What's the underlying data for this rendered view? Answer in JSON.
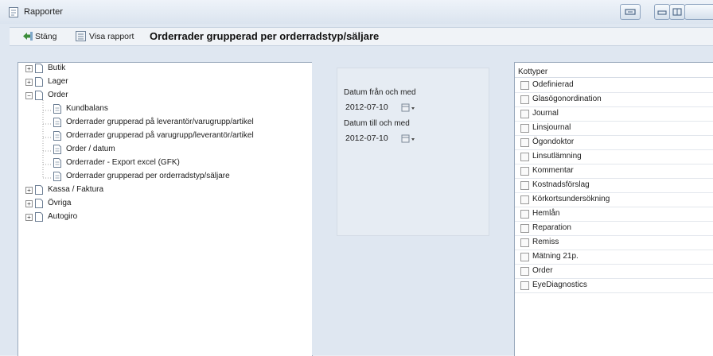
{
  "window": {
    "title": "Rapporter",
    "title_icon": "report-icon"
  },
  "toolbar": {
    "close_label": "Stäng",
    "show_report_label": "Visa rapport",
    "report_title": "Orderrader grupperad per orderradstyp/säljare"
  },
  "tree": {
    "nodes": [
      {
        "label": "Butik",
        "expander": "+"
      },
      {
        "label": "Lager",
        "expander": "+"
      },
      {
        "label": "Order",
        "expander": "−"
      },
      {
        "label": "Kundbalans"
      },
      {
        "label": "Orderrader grupperad på leverantör/varugrupp/artikel"
      },
      {
        "label": "Orderrader grupperad på varugrupp/leverantör/artikel"
      },
      {
        "label": "Order / datum"
      },
      {
        "label": "Orderrader - Export excel (GFK)"
      },
      {
        "label": "Orderrader grupperad per orderradstyp/säljare"
      },
      {
        "label": "Kassa / Faktura",
        "expander": "+"
      },
      {
        "label": "Övriga",
        "expander": "+"
      },
      {
        "label": "Autogiro",
        "expander": "+"
      }
    ]
  },
  "dates": {
    "from_label": "Datum från och med",
    "from_value": "2012-07-10",
    "to_label": "Datum till och med",
    "to_value": "2012-07-10"
  },
  "kottyper": {
    "header": "Kottyper",
    "items": [
      "Odefinierad",
      "Glasögonordination",
      "Journal",
      "Linsjournal",
      "Ögondoktor",
      "Linsutlämning",
      "Kommentar",
      "Kostnadsförslag",
      "Körkortsundersökning",
      "Hemlån",
      "Reparation",
      "Remiss",
      "Mätning 21p.",
      "Order",
      "EyeDiagnostics"
    ]
  },
  "colors": {
    "window_bg": "#dfe7f1",
    "panel_bg": "#ffffff",
    "accent": "#5b7fa8"
  }
}
